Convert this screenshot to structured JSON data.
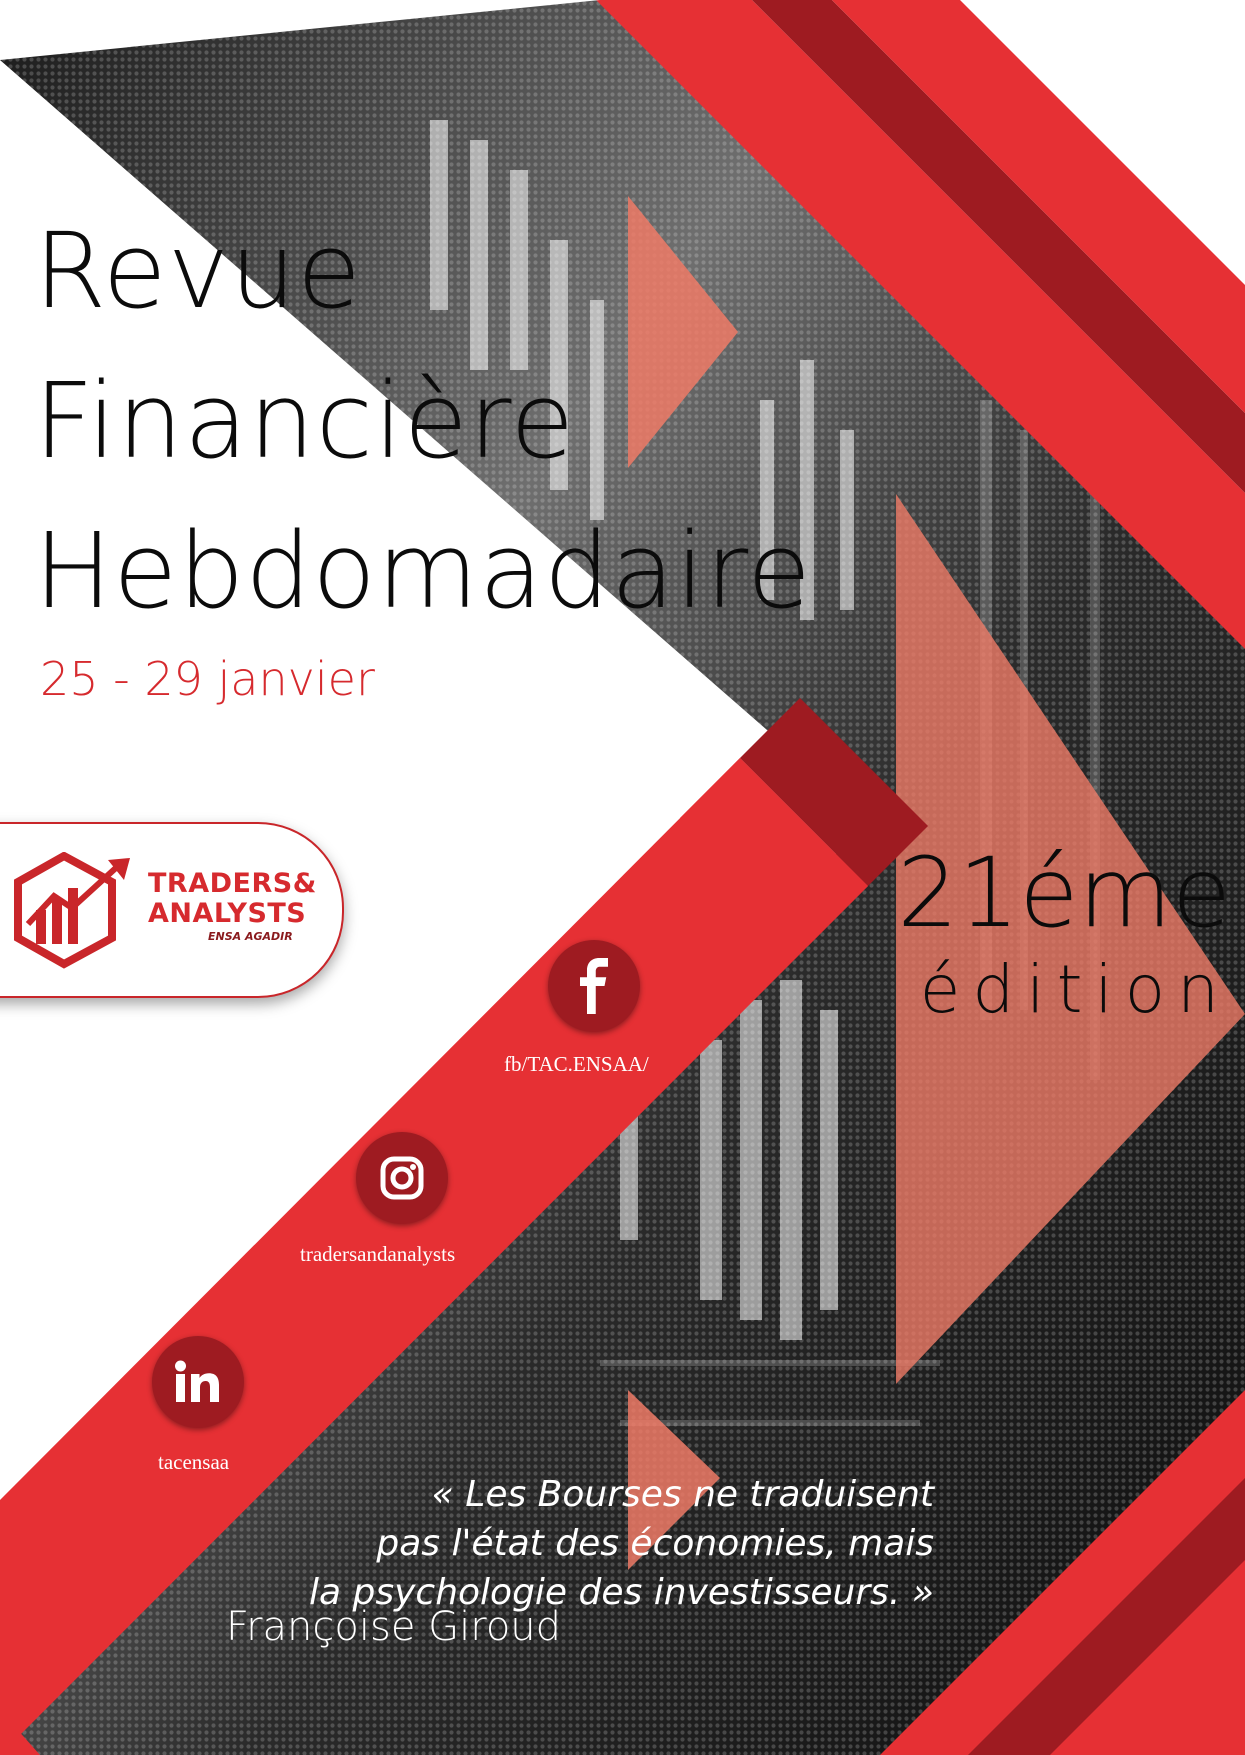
{
  "title_lines": [
    "Revue",
    "Financière",
    "Hebdomadaire"
  ],
  "date": "25 - 29 janvier",
  "edition": {
    "number": "21éme",
    "word": "édition"
  },
  "logo": {
    "line1": "TRADERS&",
    "line2": "ANALYSTS",
    "line3": "ENSA AGADIR"
  },
  "social": {
    "facebook": {
      "icon": "facebook-icon",
      "label": "fb/TAC.ENSAA/"
    },
    "instagram": {
      "icon": "instagram-icon",
      "label": "tradersandanalysts"
    },
    "linkedin": {
      "icon": "linkedin-icon",
      "label": "tacensaa"
    }
  },
  "quote": {
    "lines": [
      "«  Les Bourses ne traduisent",
      "pas  l'état  des économies, mais",
      "la psychologie des investisseurs. »"
    ],
    "author": "Françoise Giroud"
  },
  "colors": {
    "red": "#e63034",
    "dark_red": "#9e1b21",
    "salmon": "#ee7a66",
    "black": "#0b0b0b"
  }
}
